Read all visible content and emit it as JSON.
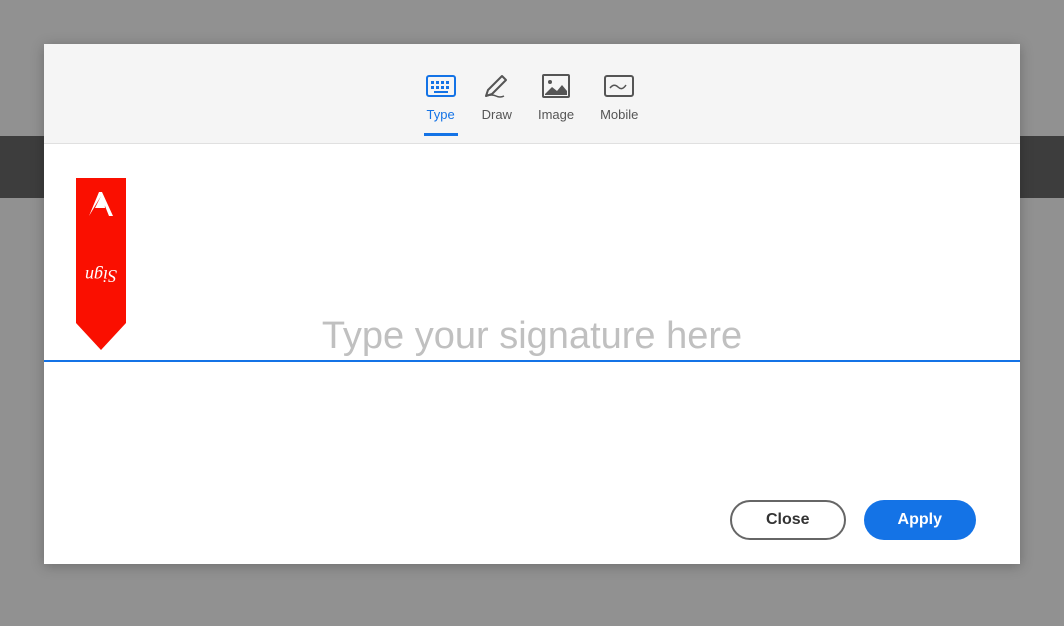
{
  "tabs": {
    "type": "Type",
    "draw": "Draw",
    "image": "Image",
    "mobile": "Mobile",
    "active": "type"
  },
  "signature": {
    "placeholder": "Type your signature here",
    "value": ""
  },
  "ribbon": {
    "label": "Sign"
  },
  "buttons": {
    "close": "Close",
    "apply": "Apply"
  },
  "colors": {
    "accent": "#1473e6",
    "ribbon": "#fa0f00"
  }
}
